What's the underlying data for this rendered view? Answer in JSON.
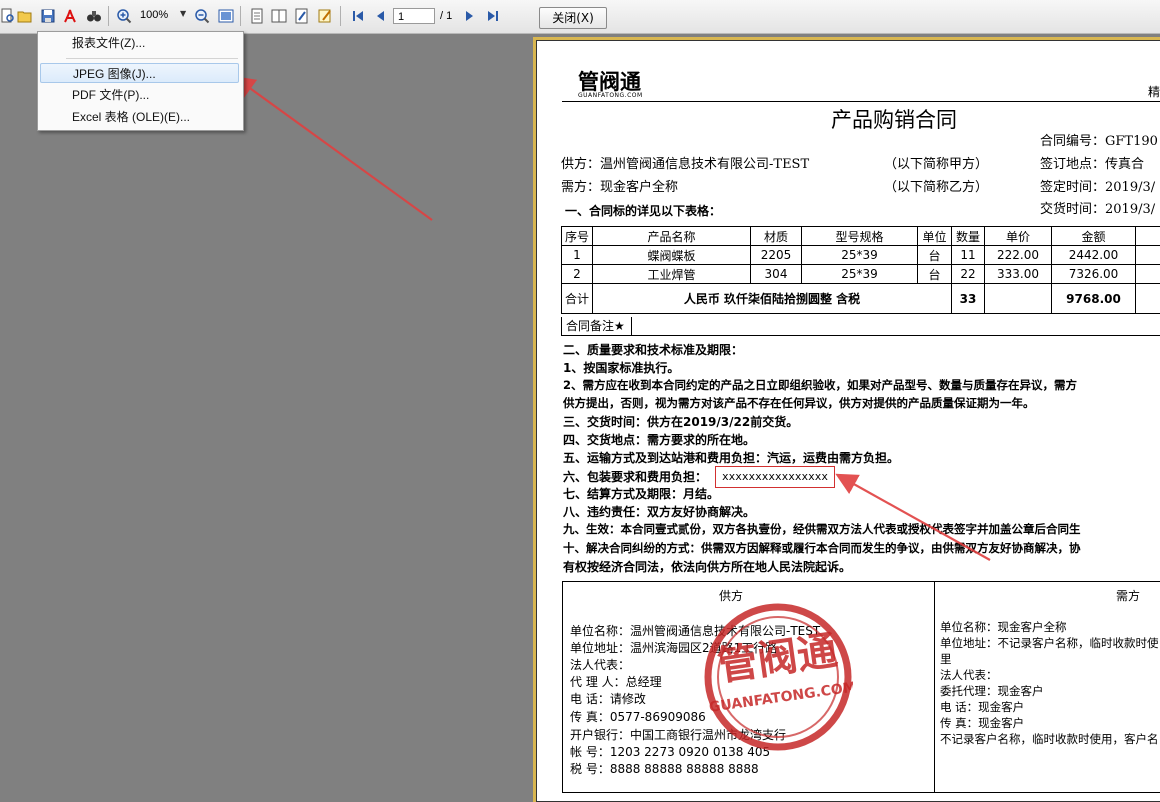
{
  "toolbar": {
    "zoom": "100%",
    "page_current": "1",
    "page_total": "/ 1",
    "close_label": "关闭(X)"
  },
  "menu": {
    "items": [
      "报表文件(Z)...",
      "JPEG 图像(J)...",
      "PDF 文件(P)...",
      "Excel 表格 (OLE)(E)..."
    ],
    "highlighted": 1
  },
  "doc": {
    "logo_text": "管阀通",
    "logo_sub": "GUANFATONG.COM",
    "corner_mark": "精",
    "title": "产品购销合同",
    "contract_no": "合同编号：GFT190",
    "supplier": "供方：温州管阀通信息技术有限公司-TEST",
    "supplier_alias": "（以下简称甲方）",
    "sign_place": "签订地点：传真合",
    "buyer": "需方：现金客户全称",
    "buyer_alias": "（以下简称乙方）",
    "sign_time": "签定时间：2019/3/",
    "delivery_time": "交货时间：2019/3/",
    "section1": "一、合同标的详见以下表格：",
    "table": {
      "headers": [
        "序号",
        "产品名称",
        "材质",
        "型号规格",
        "单位",
        "数量",
        "单价",
        "金额"
      ],
      "rows": [
        [
          "1",
          "蝶阀蝶板",
          "2205",
          "25*39",
          "台",
          "11",
          "222.00",
          "2442.00"
        ],
        [
          "2",
          "工业焊管",
          "304",
          "25*39",
          "台",
          "22",
          "333.00",
          "7326.00"
        ]
      ],
      "total_label": "合计",
      "total_words": "人民币 玖仟柒佰陆拾捌圆整 含税",
      "total_qty": "33",
      "total_amount": "9768.00"
    },
    "remark_label": "合同备注★",
    "terms": [
      "二、质量要求和技术标准及期限：",
      "  1、按国家标准执行。",
      "  2、需方应在收到本合同约定的产品之日立即组织验收，如果对产品型号、数量与质量存在异议，需方",
      "供方提出，否则，视为需方对该产品不存在任何异议，供方对提供的产品质量保证期为一年。",
      "三、交货时间：供方在2019/3/22前交货。",
      "四、交货地点：需方要求的所在地。",
      "五、运输方式及到达站港和费用负担：汽运，运费由需方负担。",
      "六、包装要求和费用负担：",
      "七、结算方式及期限：月结。",
      "八、违约责任：双方友好协商解决。",
      "九、生效：本合同壹式贰份，双方各执壹份，经供需双方法人代表或授权代表签字并加盖公章后合同生",
      "十、解决合同纠纷的方式：供需双方因解释或履行本合同而发生的争议，由供需双方友好协商解决，协",
      "有权按经济合同法，依法向供方所在地人民法院起诉。"
    ],
    "packing_value": "xxxxxxxxxxxxxxxx",
    "supplier_box": {
      "header": "供方",
      "lines": [
        "单位名称：温州管阀通信息技术有限公司-TEST",
        "单位地址：温州滨海园区2道路1工行路",
        "法人代表：",
        "代 理 人：总经理",
        "电    话：请修改",
        "传    真：0577-86909086",
        "开户银行：中国工商银行温州市龙湾支行",
        "帐    号：1203 2273 0920 0138 405",
        "税    号：8888 88888 88888 8888"
      ]
    },
    "buyer_box": {
      "header": "需方",
      "lines": [
        "单位名称：现金客户全称",
        "单位地址：不记录客户名称，临时收款时使",
        "里",
        "法人代表：",
        "委托代理：现金客户",
        "电    话：现金客户",
        "传    真：现金客户",
        "不记录客户名称，临时收款时使用，客户名"
      ]
    },
    "stamp_main": "管阀通",
    "stamp_sub": "GUANFATONG.COM"
  },
  "colors": {
    "annotation_arrow": "#e04040",
    "stamp": "#c62828",
    "menu_highlight": "#dcebfb"
  }
}
